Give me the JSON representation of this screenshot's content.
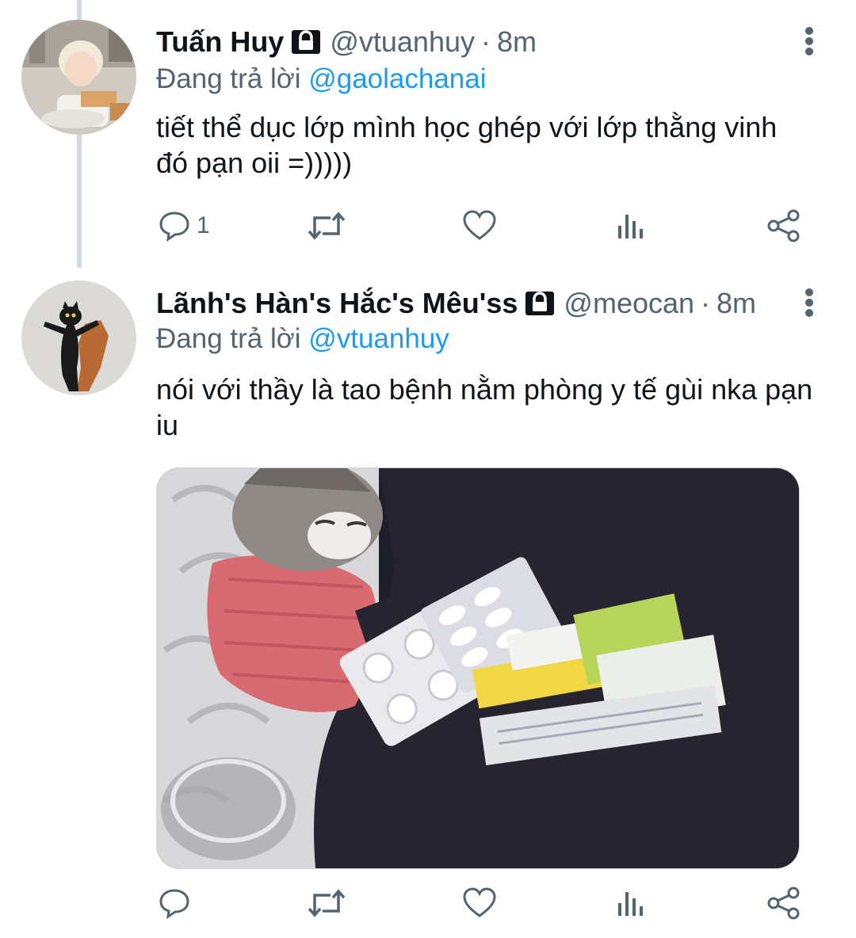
{
  "tweets": [
    {
      "display_name": "Tuấn Huy",
      "handle": "@vtuanhuy",
      "separator": "·",
      "time": "8m",
      "reply_prefix": "Đang trả lời",
      "reply_to": "@gaolachanai",
      "text": "tiết thể dục lớp mình học ghép với lớp thằng vinh đó pạn oii =)))))",
      "reply_count": "1",
      "locked": true,
      "avatar": "avatar-photo"
    },
    {
      "display_name": "Lãnh's Hàn's Hắc's Mêu'ss",
      "handle": "@meocan",
      "separator": "·",
      "time": "8m",
      "reply_prefix": "Đang trả lời",
      "reply_to": "@vtuanhuy",
      "text": "nói với thầy là tao bệnh nằm phòng y tế gùi nka pạn iu",
      "reply_count": "",
      "locked": true,
      "avatar": "avatar-black-cat",
      "media": "photo-cat-with-medicine"
    }
  ],
  "icons": {
    "reply": "speech-bubble-icon",
    "retweet": "retweet-icon",
    "like": "heart-icon",
    "views": "bar-chart-icon",
    "share": "share-icon",
    "more": "more-vertical-icon",
    "lock": "lock-icon"
  },
  "colors": {
    "text": "#0f1419",
    "secondary": "#536471",
    "accent": "#1d9bf0",
    "thread_line": "#cfd9de"
  }
}
